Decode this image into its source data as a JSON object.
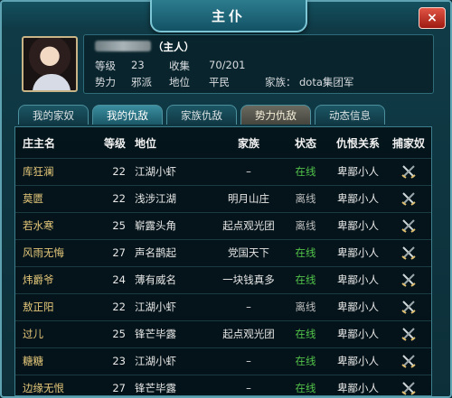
{
  "window": {
    "title": "主仆",
    "close_label": "×"
  },
  "profile": {
    "name_suffix": "（主人）",
    "level_label": "等级",
    "level": "23",
    "collect_label": "收集",
    "collect": "70/201",
    "faction_label": "势力",
    "faction": "邪派",
    "rank_label": "地位",
    "rank": "平民",
    "family_label": "家族：",
    "family": "dota集团军"
  },
  "tabs": [
    {
      "label": "我的家奴"
    },
    {
      "label": "我的仇敌"
    },
    {
      "label": "家族仇敌"
    },
    {
      "label": "势力仇敌"
    },
    {
      "label": "动态信息"
    }
  ],
  "table": {
    "headers": {
      "name": "庄主名",
      "level": "等级",
      "rank": "地位",
      "family": "家族",
      "status": "状态",
      "relation": "仇恨关系",
      "action": "捕家奴"
    },
    "rows": [
      {
        "name": "库狂澜",
        "level": "22",
        "rank": "江湖小虾",
        "family": "–",
        "status": "在线",
        "relation": "卑鄙小人"
      },
      {
        "name": "莫匮",
        "level": "22",
        "rank": "浅涉江湖",
        "family": "明月山庄",
        "status": "离线",
        "relation": "卑鄙小人"
      },
      {
        "name": "若水寒",
        "level": "25",
        "rank": "崭露头角",
        "family": "起点观光团",
        "status": "离线",
        "relation": "卑鄙小人"
      },
      {
        "name": "风雨无悔",
        "level": "27",
        "rank": "声名鹊起",
        "family": "党国天下",
        "status": "在线",
        "relation": "卑鄙小人"
      },
      {
        "name": "炜爵爷",
        "level": "24",
        "rank": "薄有威名",
        "family": "一块钱真多",
        "status": "在线",
        "relation": "卑鄙小人"
      },
      {
        "name": "敖正阳",
        "level": "22",
        "rank": "江湖小虾",
        "family": "–",
        "status": "离线",
        "relation": "卑鄙小人"
      },
      {
        "name": "过儿",
        "level": "25",
        "rank": "锋芒毕露",
        "family": "起点观光团",
        "status": "在线",
        "relation": "卑鄙小人"
      },
      {
        "name": "糖糖",
        "level": "23",
        "rank": "江湖小虾",
        "family": "–",
        "status": "在线",
        "relation": "卑鄙小人"
      },
      {
        "name": "边缘无恨",
        "level": "27",
        "rank": "锋芒毕露",
        "family": "–",
        "status": "在线",
        "relation": "卑鄙小人"
      }
    ]
  }
}
